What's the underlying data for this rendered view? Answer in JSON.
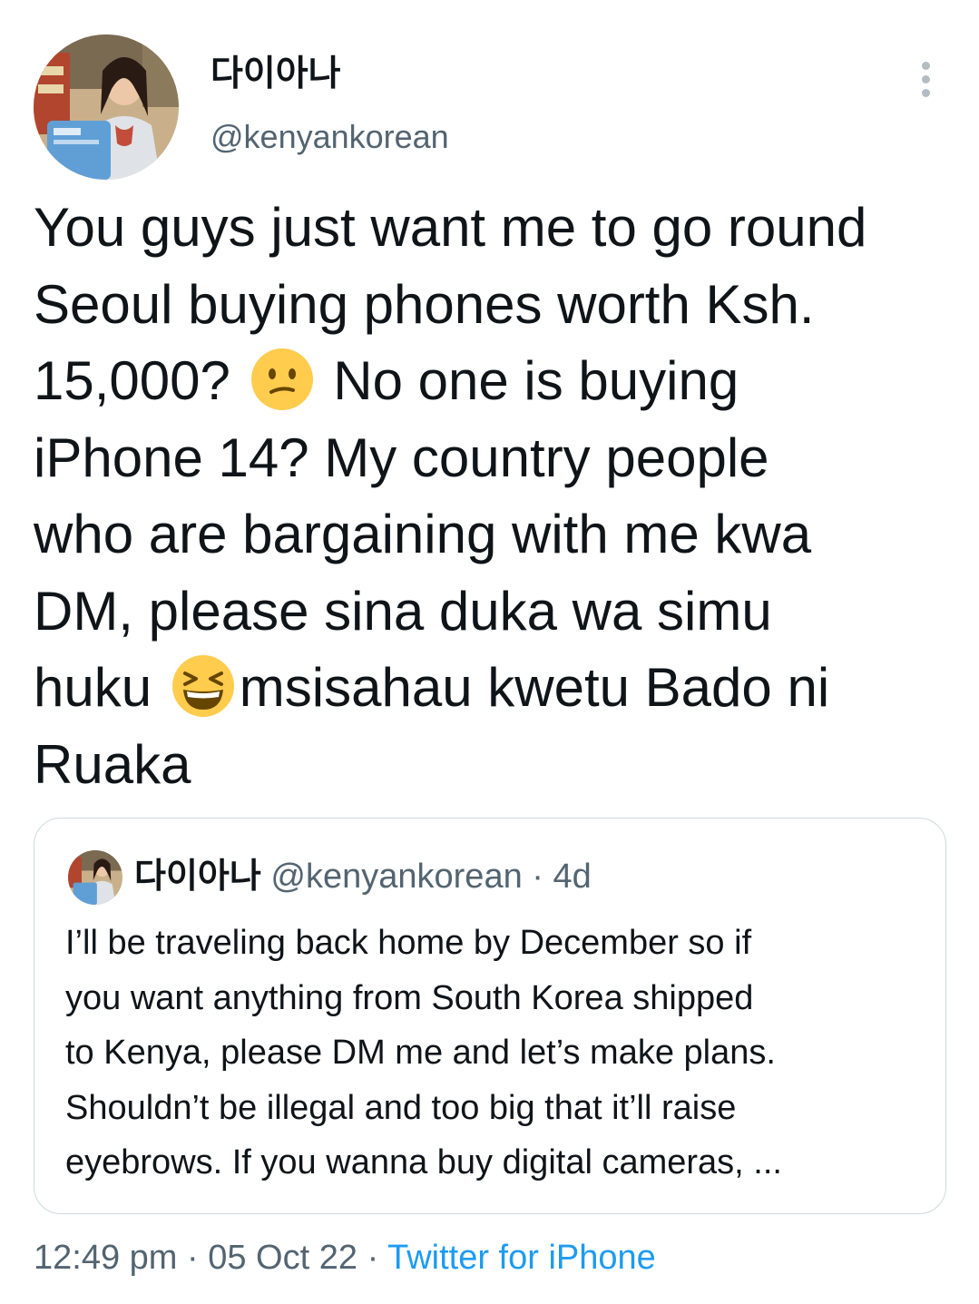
{
  "author": {
    "display_name": "다이아나",
    "handle": "@kenyankorean"
  },
  "tweet": {
    "lines": [
      {
        "text": "You guys just want me to go round"
      },
      {
        "text": "Seoul buying phones worth Ksh."
      },
      {
        "before": "15,000?",
        "emoji": "confused-face",
        "after": "No one is buying"
      },
      {
        "text": "iPhone 14? My country people"
      },
      {
        "text": "who are bargaining with me kwa"
      },
      {
        "text": "DM, please sina duka wa simu"
      },
      {
        "before": "huku",
        "emoji": "grinning-squinting-face",
        "after": "msisahau kwetu Bado ni"
      },
      {
        "text": "Ruaka"
      }
    ]
  },
  "quoted_tweet": {
    "display_name": "다이아나",
    "handle": "@kenyankorean",
    "separator": "·",
    "time": "4d",
    "lines": [
      "I’ll be traveling back home by December so if",
      "you want anything from South Korea shipped",
      "to Kenya, please DM me and let’s make plans.",
      "Shouldn’t be illegal and too big that it’ll raise",
      "eyebrows. If you wanna buy digital cameras, ..."
    ]
  },
  "meta": {
    "time": "12:49 pm",
    "separator": "·",
    "date": "05 Oct 22",
    "source": "Twitter for iPhone"
  },
  "icons": {
    "more": "more-options-icon"
  },
  "colors": {
    "text": "#0f1419",
    "secondary": "#536471",
    "link": "#1d9bf0",
    "border": "#cfd9de",
    "emoji": "#ffcc4d"
  }
}
